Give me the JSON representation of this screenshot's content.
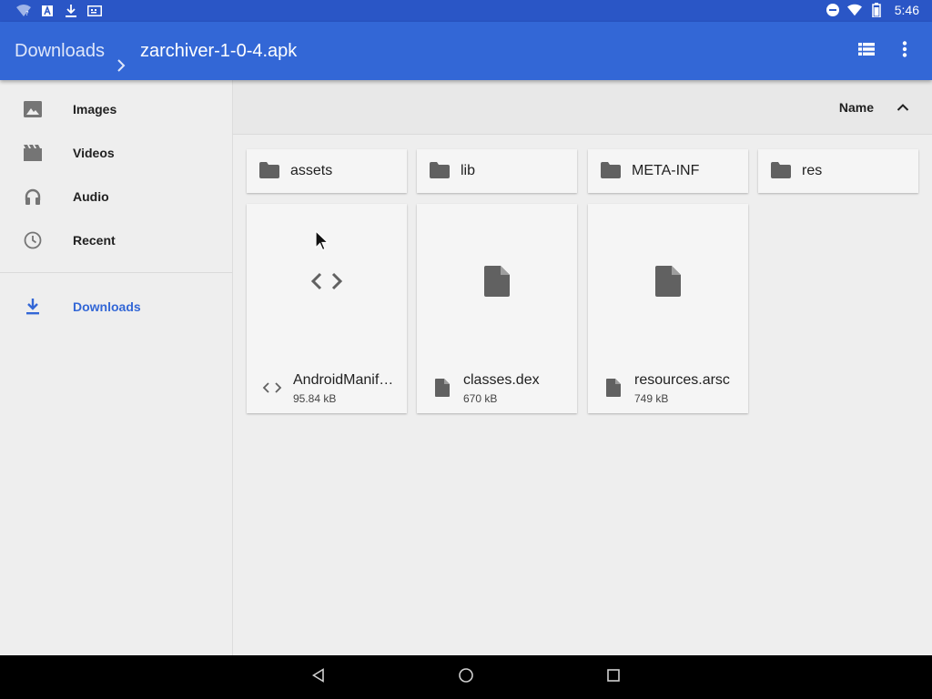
{
  "status_bar": {
    "time": "5:46",
    "left_icons": [
      "wifi-question-icon",
      "font-a-icon",
      "download-icon",
      "keyboard-icon"
    ],
    "right_icons": [
      "do-not-disturb-icon",
      "wifi-icon",
      "battery-icon"
    ]
  },
  "app_bar": {
    "breadcrumb_root": "Downloads",
    "breadcrumb_current": "zarchiver-1-0-4.apk",
    "actions": [
      "list-view-icon",
      "more-vert-icon"
    ],
    "background": "#3367d6"
  },
  "drawer": {
    "items": [
      {
        "label": "Images",
        "icon": "image-icon"
      },
      {
        "label": "Videos",
        "icon": "movie-icon"
      },
      {
        "label": "Audio",
        "icon": "headphones-icon"
      },
      {
        "label": "Recent",
        "icon": "clock-icon"
      }
    ],
    "downloads": {
      "label": "Downloads",
      "icon": "download-icon",
      "active": true,
      "color": "#3367d6"
    }
  },
  "sort_bar": {
    "label": "Name",
    "direction": "ascending"
  },
  "folders": [
    {
      "name": "assets"
    },
    {
      "name": "lib"
    },
    {
      "name": "META-INF"
    },
    {
      "name": "res"
    }
  ],
  "files": [
    {
      "name": "AndroidManif…",
      "size": "95.84 kB",
      "icon": "code-icon"
    },
    {
      "name": "classes.dex",
      "size": "670 kB",
      "icon": "file-icon"
    },
    {
      "name": "resources.arsc",
      "size": "749 kB",
      "icon": "file-icon"
    }
  ],
  "nav_bar": {
    "buttons": [
      "back-icon",
      "home-icon",
      "recents-icon"
    ]
  }
}
